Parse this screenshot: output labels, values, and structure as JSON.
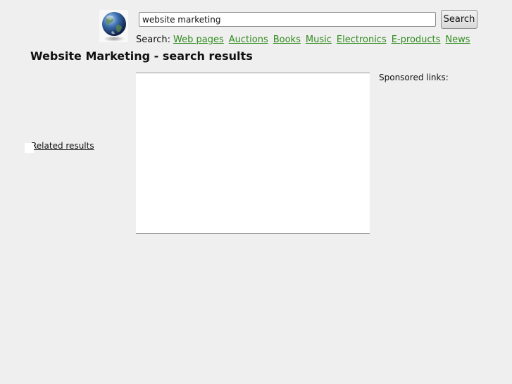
{
  "search": {
    "query": "website marketing",
    "button_label": "Search"
  },
  "nav": {
    "prefix": "Search:",
    "links": [
      "Web pages",
      "Auctions",
      "Books",
      "Music",
      "Electronics",
      "E-products",
      "News"
    ]
  },
  "page_title": "Website Marketing - search results",
  "sponsored_label": "Sponsored links:",
  "related_results_label": "Related results",
  "colors": {
    "background": "#efefef",
    "link_green": "#2f8a1d",
    "frame_border": "#9a9a9a"
  },
  "icons": {
    "logo": "globe-icon"
  }
}
